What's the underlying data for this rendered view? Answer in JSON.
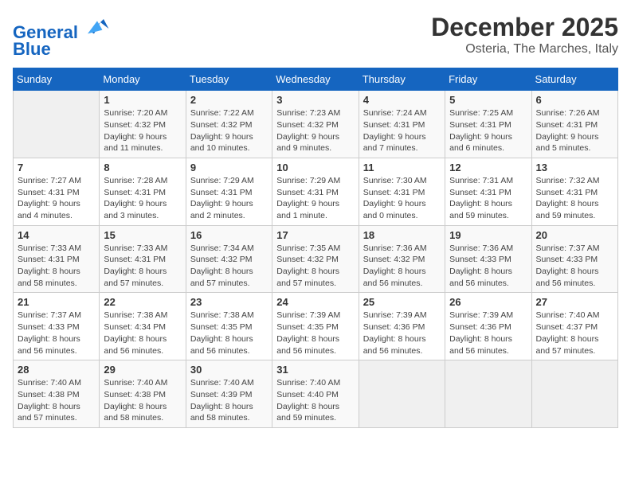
{
  "logo": {
    "line1": "General",
    "line2": "Blue"
  },
  "title": "December 2025",
  "location": "Osteria, The Marches, Italy",
  "days_of_week": [
    "Sunday",
    "Monday",
    "Tuesday",
    "Wednesday",
    "Thursday",
    "Friday",
    "Saturday"
  ],
  "weeks": [
    [
      {
        "day": "",
        "detail": ""
      },
      {
        "day": "1",
        "detail": "Sunrise: 7:20 AM\nSunset: 4:32 PM\nDaylight: 9 hours\nand 11 minutes."
      },
      {
        "day": "2",
        "detail": "Sunrise: 7:22 AM\nSunset: 4:32 PM\nDaylight: 9 hours\nand 10 minutes."
      },
      {
        "day": "3",
        "detail": "Sunrise: 7:23 AM\nSunset: 4:32 PM\nDaylight: 9 hours\nand 9 minutes."
      },
      {
        "day": "4",
        "detail": "Sunrise: 7:24 AM\nSunset: 4:31 PM\nDaylight: 9 hours\nand 7 minutes."
      },
      {
        "day": "5",
        "detail": "Sunrise: 7:25 AM\nSunset: 4:31 PM\nDaylight: 9 hours\nand 6 minutes."
      },
      {
        "day": "6",
        "detail": "Sunrise: 7:26 AM\nSunset: 4:31 PM\nDaylight: 9 hours\nand 5 minutes."
      }
    ],
    [
      {
        "day": "7",
        "detail": "Sunrise: 7:27 AM\nSunset: 4:31 PM\nDaylight: 9 hours\nand 4 minutes."
      },
      {
        "day": "8",
        "detail": "Sunrise: 7:28 AM\nSunset: 4:31 PM\nDaylight: 9 hours\nand 3 minutes."
      },
      {
        "day": "9",
        "detail": "Sunrise: 7:29 AM\nSunset: 4:31 PM\nDaylight: 9 hours\nand 2 minutes."
      },
      {
        "day": "10",
        "detail": "Sunrise: 7:29 AM\nSunset: 4:31 PM\nDaylight: 9 hours\nand 1 minute."
      },
      {
        "day": "11",
        "detail": "Sunrise: 7:30 AM\nSunset: 4:31 PM\nDaylight: 9 hours\nand 0 minutes."
      },
      {
        "day": "12",
        "detail": "Sunrise: 7:31 AM\nSunset: 4:31 PM\nDaylight: 8 hours\nand 59 minutes."
      },
      {
        "day": "13",
        "detail": "Sunrise: 7:32 AM\nSunset: 4:31 PM\nDaylight: 8 hours\nand 59 minutes."
      }
    ],
    [
      {
        "day": "14",
        "detail": "Sunrise: 7:33 AM\nSunset: 4:31 PM\nDaylight: 8 hours\nand 58 minutes."
      },
      {
        "day": "15",
        "detail": "Sunrise: 7:33 AM\nSunset: 4:31 PM\nDaylight: 8 hours\nand 57 minutes."
      },
      {
        "day": "16",
        "detail": "Sunrise: 7:34 AM\nSunset: 4:32 PM\nDaylight: 8 hours\nand 57 minutes."
      },
      {
        "day": "17",
        "detail": "Sunrise: 7:35 AM\nSunset: 4:32 PM\nDaylight: 8 hours\nand 57 minutes."
      },
      {
        "day": "18",
        "detail": "Sunrise: 7:36 AM\nSunset: 4:32 PM\nDaylight: 8 hours\nand 56 minutes."
      },
      {
        "day": "19",
        "detail": "Sunrise: 7:36 AM\nSunset: 4:33 PM\nDaylight: 8 hours\nand 56 minutes."
      },
      {
        "day": "20",
        "detail": "Sunrise: 7:37 AM\nSunset: 4:33 PM\nDaylight: 8 hours\nand 56 minutes."
      }
    ],
    [
      {
        "day": "21",
        "detail": "Sunrise: 7:37 AM\nSunset: 4:33 PM\nDaylight: 8 hours\nand 56 minutes."
      },
      {
        "day": "22",
        "detail": "Sunrise: 7:38 AM\nSunset: 4:34 PM\nDaylight: 8 hours\nand 56 minutes."
      },
      {
        "day": "23",
        "detail": "Sunrise: 7:38 AM\nSunset: 4:35 PM\nDaylight: 8 hours\nand 56 minutes."
      },
      {
        "day": "24",
        "detail": "Sunrise: 7:39 AM\nSunset: 4:35 PM\nDaylight: 8 hours\nand 56 minutes."
      },
      {
        "day": "25",
        "detail": "Sunrise: 7:39 AM\nSunset: 4:36 PM\nDaylight: 8 hours\nand 56 minutes."
      },
      {
        "day": "26",
        "detail": "Sunrise: 7:39 AM\nSunset: 4:36 PM\nDaylight: 8 hours\nand 56 minutes."
      },
      {
        "day": "27",
        "detail": "Sunrise: 7:40 AM\nSunset: 4:37 PM\nDaylight: 8 hours\nand 57 minutes."
      }
    ],
    [
      {
        "day": "28",
        "detail": "Sunrise: 7:40 AM\nSunset: 4:38 PM\nDaylight: 8 hours\nand 57 minutes."
      },
      {
        "day": "29",
        "detail": "Sunrise: 7:40 AM\nSunset: 4:38 PM\nDaylight: 8 hours\nand 58 minutes."
      },
      {
        "day": "30",
        "detail": "Sunrise: 7:40 AM\nSunset: 4:39 PM\nDaylight: 8 hours\nand 58 minutes."
      },
      {
        "day": "31",
        "detail": "Sunrise: 7:40 AM\nSunset: 4:40 PM\nDaylight: 8 hours\nand 59 minutes."
      },
      {
        "day": "",
        "detail": ""
      },
      {
        "day": "",
        "detail": ""
      },
      {
        "day": "",
        "detail": ""
      }
    ]
  ]
}
